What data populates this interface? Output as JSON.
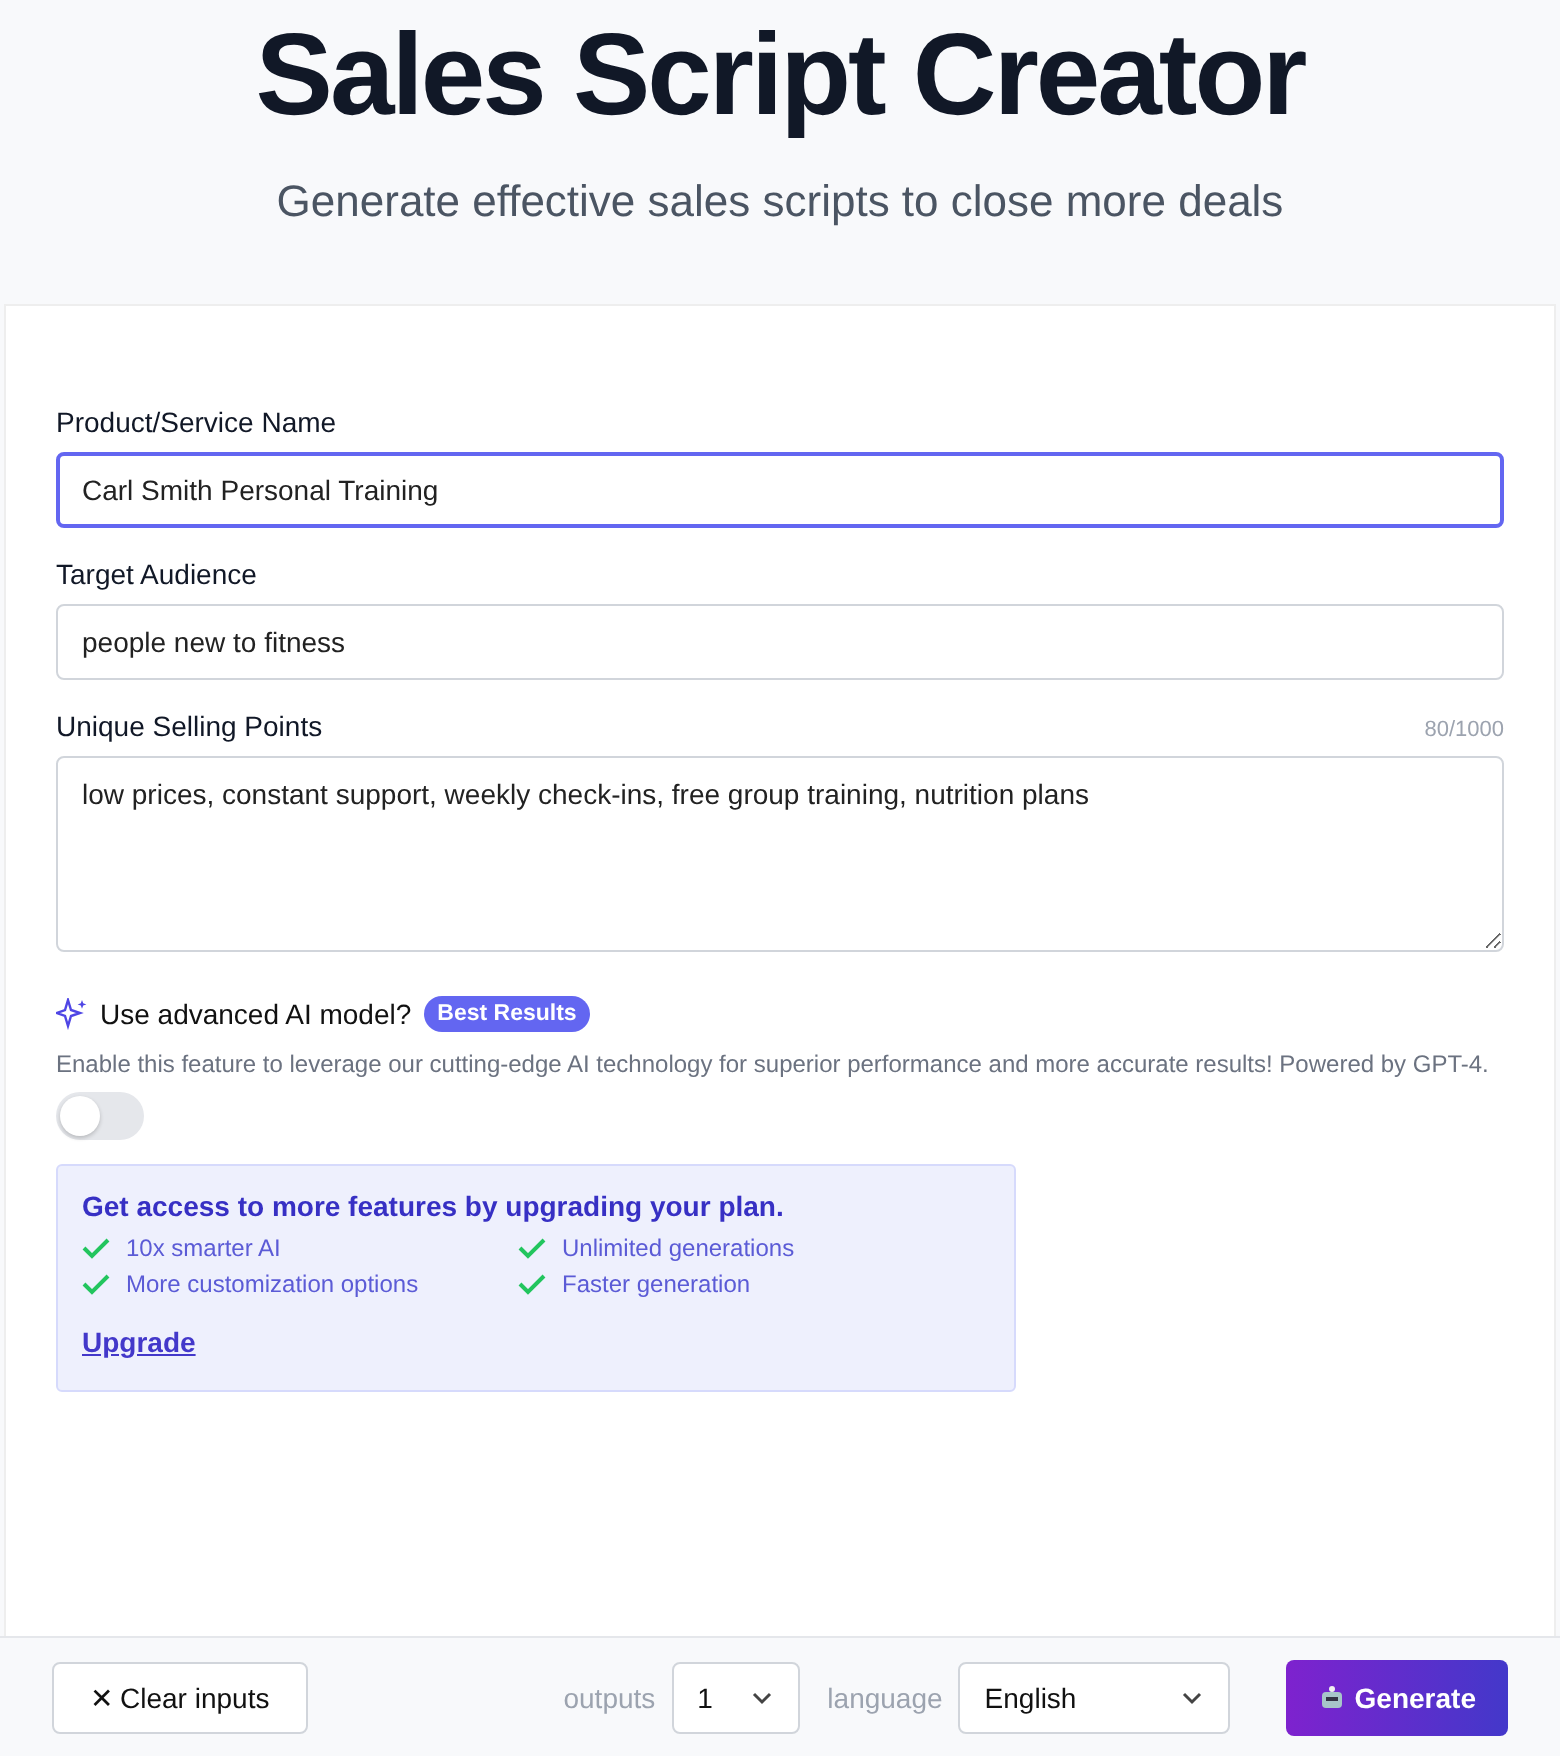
{
  "header": {
    "title": "Sales Script Creator",
    "subtitle": "Generate effective sales scripts to close more deals"
  },
  "fields": [
    {
      "kind": "input",
      "label": "Product/Service Name",
      "value": "Carl Smith Personal Training",
      "focused": true
    },
    {
      "kind": "input",
      "label": "Target Audience",
      "value": "people new to fitness",
      "focused": false
    },
    {
      "kind": "textarea",
      "label": "Unique Selling Points",
      "counter": "80/1000",
      "value": "low prices, constant support, weekly check-ins, free group training, nutrition plans",
      "focused": false
    }
  ],
  "advanced": {
    "label": "Use advanced AI model?",
    "badge": "Best Results",
    "description": "Enable this feature to leverage our cutting-edge AI technology for superior performance and more accurate results! Powered by GPT-4.",
    "on": false
  },
  "upgrade": {
    "title": "Get access to more features by upgrading your plan.",
    "features": [
      "10x smarter AI",
      "Unlimited generations",
      "More customization options",
      "Faster generation"
    ],
    "link": "Upgrade"
  },
  "footer": {
    "clear": {
      "icon": "✕",
      "label": "Clear inputs"
    },
    "outputs_label": "outputs",
    "outputs_value": "1",
    "language_label": "language",
    "language_value": "English",
    "generate": "Generate"
  }
}
